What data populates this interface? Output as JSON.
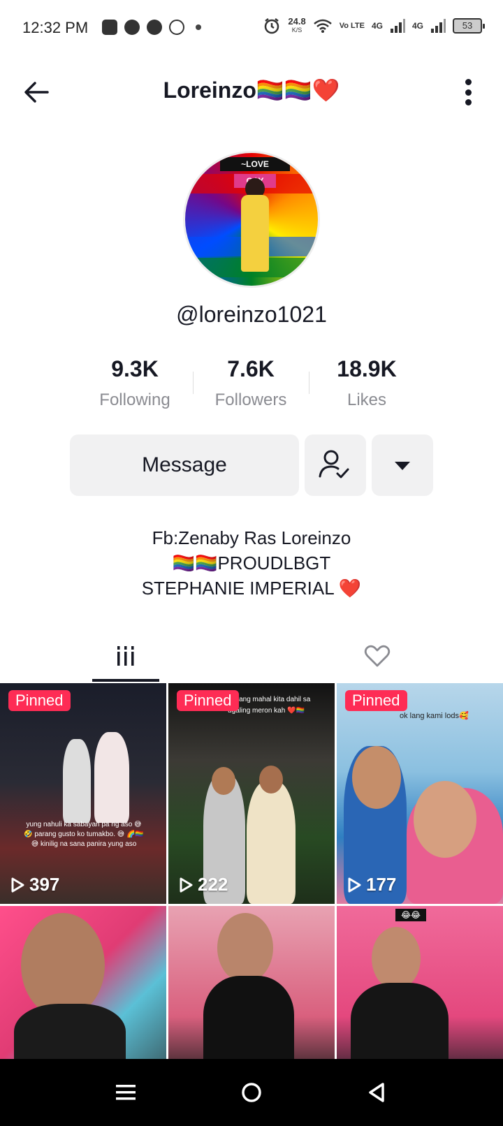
{
  "status_bar": {
    "time": "12:32 PM",
    "speed_value": "24.8",
    "speed_unit": "K/S",
    "volte": "Vo LTE",
    "net1": "4G",
    "net2": "4G",
    "battery": "53"
  },
  "header": {
    "title": "Loreinzo🏳️‍🌈🏳️‍🌈❤️"
  },
  "avatar": {
    "banner_text": "~LOVE",
    "sign_text": "GAY"
  },
  "profile": {
    "username": "@loreinzo1021"
  },
  "stats": [
    {
      "value": "9.3K",
      "label": "Following"
    },
    {
      "value": "7.6K",
      "label": "Followers"
    },
    {
      "value": "18.9K",
      "label": "Likes"
    }
  ],
  "actions": {
    "message_label": "Message"
  },
  "bio": {
    "line1": "Fb:Zenaby Ras Loreinzo",
    "line2": "🏳️‍🌈🏳️‍🌈PROUDLBGT",
    "line3": "STEPHANIE IMPERIAL ❤️"
  },
  "videos": [
    {
      "pinned": "Pinned",
      "views": "397",
      "caption": "yung nahuli ka sabayan pa ng aso 😅 🤣 parang gusto ko tumakbo. 😅 🌈🏳️‍🌈 😅 kinilig na sana panira yung aso"
    },
    {
      "pinned": "Pinned",
      "views": "222",
      "caption": "mukhang mahal kita dahil sa ugaling meron kah ❤️🏳️‍🌈"
    },
    {
      "pinned": "Pinned",
      "views": "177",
      "caption": "ok lang kami lods🥰"
    },
    {
      "pinned": "",
      "views": "",
      "caption": ""
    },
    {
      "pinned": "",
      "views": "",
      "caption": ""
    },
    {
      "pinned": "",
      "views": "",
      "caption": "😂😂"
    }
  ],
  "colors": {
    "accent": "#fe2c55",
    "text": "#161823",
    "secondary_text": "#8a8b91",
    "button_bg": "#f1f1f2"
  },
  "icons": {
    "back": "arrow-left-icon",
    "more": "vertical-dots-icon",
    "follow_status": "user-check-icon",
    "dropdown": "caret-down-icon",
    "videos_tab": "grid-bars-icon",
    "liked_tab": "heart-outline-icon",
    "play": "play-icon"
  }
}
